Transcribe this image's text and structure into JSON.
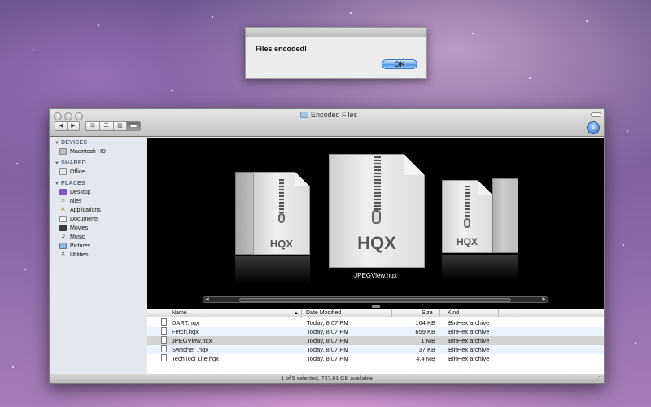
{
  "alert": {
    "message": "Files encoded!",
    "ok_label": "OK"
  },
  "window": {
    "title": "Encoded Files",
    "view_buttons": [
      "⊞",
      "☰",
      "▥",
      "▬"
    ],
    "status": "1 of 5 selected, 727.91 GB available"
  },
  "sidebar": {
    "sections": [
      {
        "label": "DEVICES",
        "items": [
          {
            "label": "Macintosh HD",
            "icon": "hard-drive-icon"
          }
        ]
      },
      {
        "label": "SHARED",
        "items": [
          {
            "label": "Office",
            "icon": "network-computer-icon"
          }
        ]
      },
      {
        "label": "PLACES",
        "items": [
          {
            "label": "Desktop",
            "icon": "desktop-icon"
          },
          {
            "label": "niles",
            "icon": "home-icon"
          },
          {
            "label": "Applications",
            "icon": "applications-icon"
          },
          {
            "label": "Documents",
            "icon": "documents-icon"
          },
          {
            "label": "Movies",
            "icon": "movies-icon"
          },
          {
            "label": "Music",
            "icon": "music-icon"
          },
          {
            "label": "Pictures",
            "icon": "pictures-icon"
          },
          {
            "label": "Utilities",
            "icon": "utilities-icon"
          }
        ]
      }
    ]
  },
  "coverflow": {
    "badge": "HQX",
    "caption": "JPEGView.hqx"
  },
  "list": {
    "columns": {
      "name": "Name",
      "date": "Date Modified",
      "size": "Size",
      "kind": "Kind"
    },
    "rows": [
      {
        "name": "DART.hqx",
        "date": "Today, 8:07 PM",
        "size": "164 KB",
        "kind": "BinHex archive"
      },
      {
        "name": "Fetch.hqx",
        "date": "Today, 8:07 PM",
        "size": "659 KB",
        "kind": "BinHex archive"
      },
      {
        "name": "JPEGView.hqx",
        "date": "Today, 8:07 PM",
        "size": "1 MB",
        "kind": "BinHex archive"
      },
      {
        "name": "Switcher .hqx",
        "date": "Today, 8:07 PM",
        "size": "37 KB",
        "kind": "BinHex archive"
      },
      {
        "name": "TechTool Lite.hqx",
        "date": "Today, 8:07 PM",
        "size": "4.4 MB",
        "kind": "BinHex archive"
      }
    ]
  }
}
